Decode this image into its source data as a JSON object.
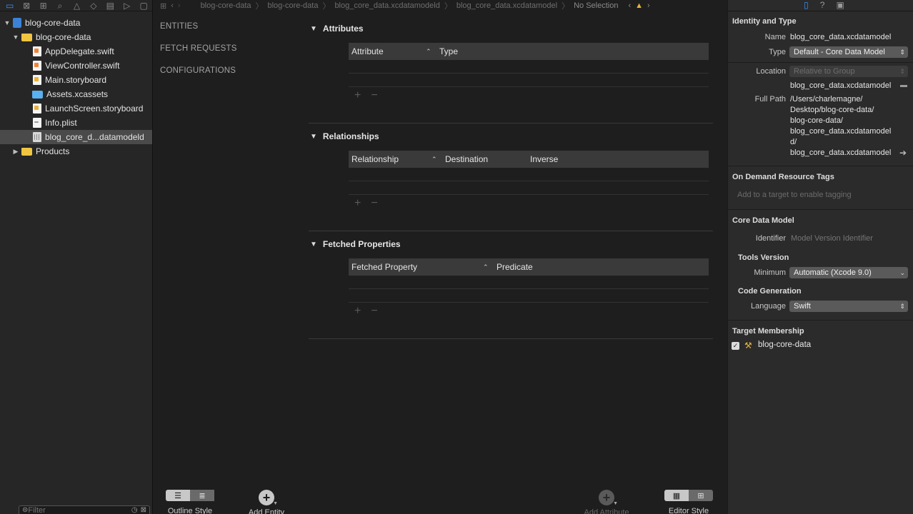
{
  "navigator": {
    "toolbar_icons": [
      "folder-icon",
      "source-control-icon",
      "symbol-icon",
      "find-icon",
      "issue-icon",
      "test-icon",
      "debug-icon",
      "breakpoint-icon",
      "report-icon"
    ],
    "tree": [
      {
        "label": "blog-core-data",
        "icon": "project-icon",
        "depth": 0,
        "disclosure": "▼"
      },
      {
        "label": "blog-core-data",
        "icon": "folder-icon",
        "depth": 1,
        "disclosure": "▼"
      },
      {
        "label": "AppDelegate.swift",
        "icon": "swift-file-icon",
        "depth": 2,
        "disclosure": ""
      },
      {
        "label": "ViewController.swift",
        "icon": "swift-file-icon",
        "depth": 2,
        "disclosure": ""
      },
      {
        "label": "Main.storyboard",
        "icon": "storyboard-file-icon",
        "depth": 2,
        "disclosure": ""
      },
      {
        "label": "Assets.xcassets",
        "icon": "asset-folder-icon",
        "depth": 2,
        "disclosure": ""
      },
      {
        "label": "LaunchScreen.storyboard",
        "icon": "storyboard-file-icon",
        "depth": 2,
        "disclosure": ""
      },
      {
        "label": "Info.plist",
        "icon": "plist-file-icon",
        "depth": 2,
        "disclosure": ""
      },
      {
        "label": "blog_core_d...datamodeld",
        "icon": "data-model-icon",
        "depth": 2,
        "disclosure": "",
        "selected": true
      },
      {
        "label": "Products",
        "icon": "folder-icon",
        "depth": 1,
        "disclosure": "▶"
      }
    ],
    "filter_placeholder": "Filter"
  },
  "jumpbar": {
    "items": [
      "blog-core-data",
      "blog-core-data",
      "blog_core_data.xcdatamodeld",
      "blog_core_data.xcdatamodel",
      "No Selection"
    ]
  },
  "model_sidebar": {
    "entities": "ENTITIES",
    "fetch_requests": "FETCH REQUESTS",
    "configurations": "CONFIGURATIONS"
  },
  "sections": {
    "attributes": {
      "title": "Attributes",
      "columns": [
        "Attribute",
        "Type"
      ]
    },
    "relationships": {
      "title": "Relationships",
      "columns": [
        "Relationship",
        "Destination",
        "Inverse"
      ]
    },
    "fetched": {
      "title": "Fetched Properties",
      "columns": [
        "Fetched Property",
        "Predicate"
      ]
    }
  },
  "bottom_toolbar": {
    "outline_style": "Outline Style",
    "add_entity": "Add Entity",
    "add_attribute": "Add Attribute",
    "editor_style": "Editor Style"
  },
  "inspector": {
    "identity_heading": "Identity and Type",
    "name_label": "Name",
    "name_value": "blog_core_data.xcdatamodel",
    "type_label": "Type",
    "type_value": "Default - Core Data Model",
    "location_label": "Location",
    "location_value": "Relative to Group",
    "location_file": "blog_core_data.xcdatamodel",
    "fullpath_label": "Full Path",
    "fullpath_lines": [
      "/Users/charlemagne/",
      "Desktop/blog-core-data/",
      "blog-core-data/",
      "blog_core_data.xcdatamodel",
      "d/",
      "blog_core_data.xcdatamodel"
    ],
    "odr_heading": "On Demand Resource Tags",
    "odr_placeholder": "Add to a target to enable tagging",
    "cdm_heading": "Core Data Model",
    "identifier_label": "Identifier",
    "identifier_placeholder": "Model Version Identifier",
    "tools_version": "Tools Version",
    "minimum_label": "Minimum",
    "minimum_value": "Automatic (Xcode 9.0)",
    "code_gen": "Code Generation",
    "language_label": "Language",
    "language_value": "Swift",
    "target_heading": "Target Membership",
    "target_name": "blog-core-data"
  }
}
